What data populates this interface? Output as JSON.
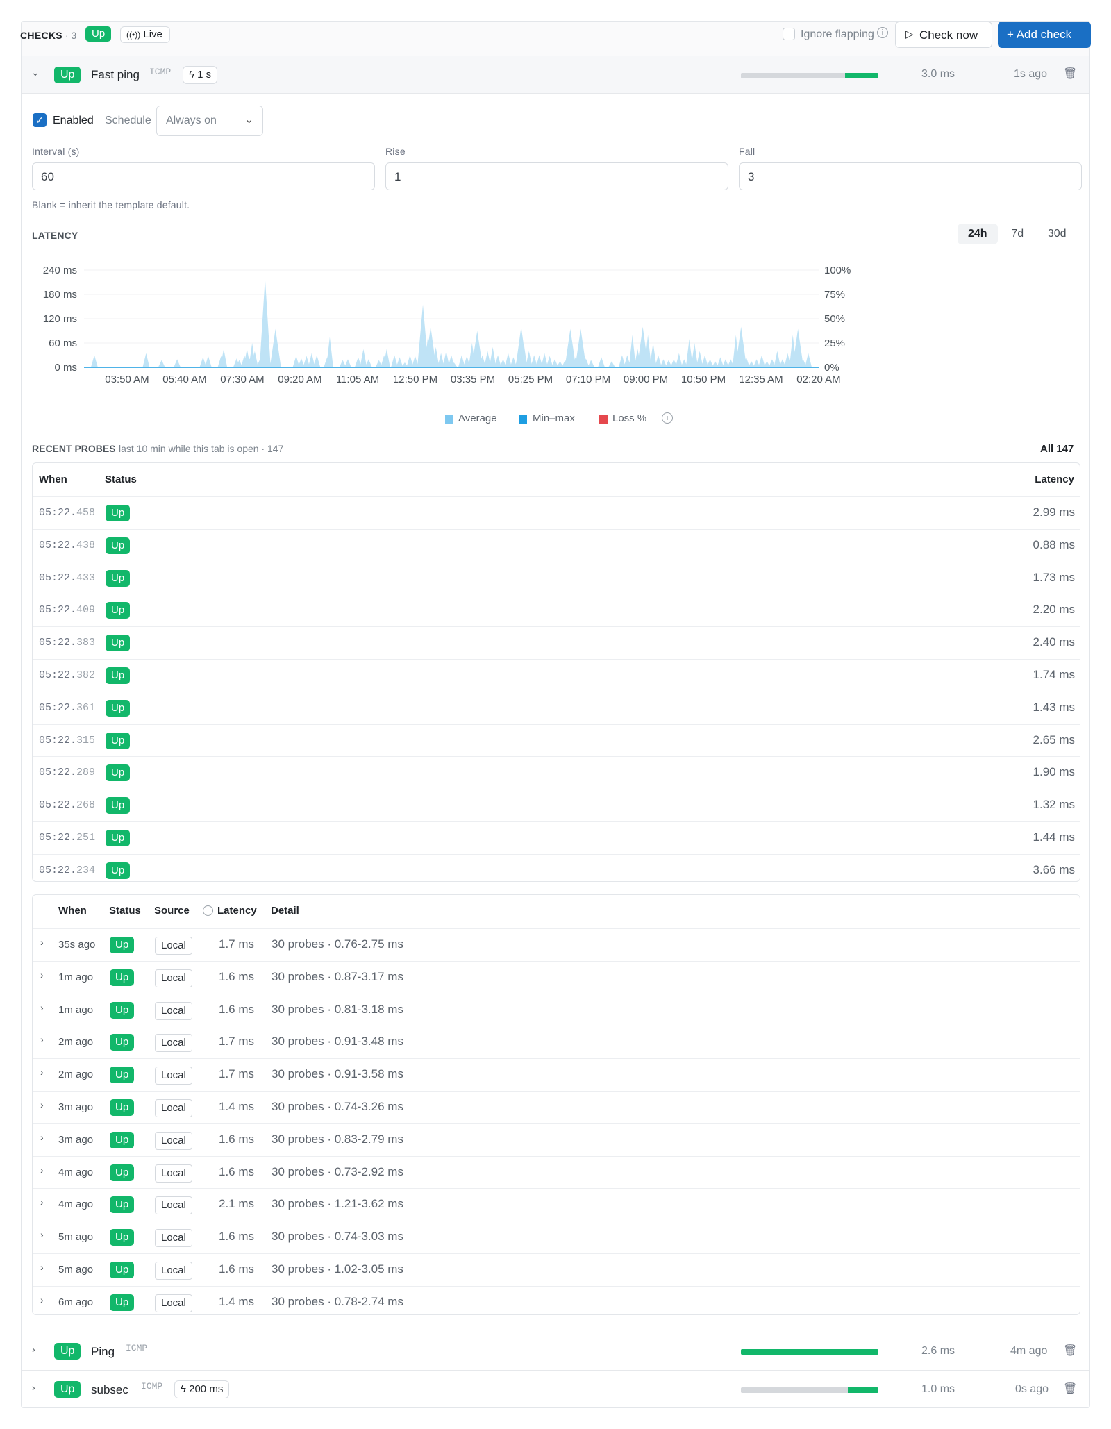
{
  "header": {
    "checks_label": "CHECKS",
    "checks_count": "· 3",
    "status": "Up",
    "live_label": "Live",
    "ignore_flapping": "Ignore flapping",
    "check_now": "Check now",
    "add_check": "+ Add check"
  },
  "check1": {
    "status": "Up",
    "name": "Fast ping",
    "type": "ICMP",
    "interval": "1 s",
    "bar_up_fraction": 0.24,
    "latency": "3.0 ms",
    "ago": "1s ago",
    "enabled_label": "Enabled",
    "schedule_label": "Schedule",
    "schedule_value": "Always on",
    "interval_label": "Interval (s)",
    "interval_value": "60",
    "rise_label": "Rise",
    "rise_value": "1",
    "fall_label": "Fall",
    "fall_value": "3",
    "hint": "Blank = inherit the template default."
  },
  "latency": {
    "title": "LATENCY",
    "ranges": [
      "24h",
      "7d",
      "30d"
    ],
    "active_range": "24h",
    "legend": [
      "Average",
      "Min–max",
      "Loss %"
    ]
  },
  "chart_data": {
    "type": "area",
    "y_ticks_left": [
      "240 ms",
      "180 ms",
      "120 ms",
      "60 ms",
      "0 ms"
    ],
    "y_ticks_right": [
      "100%",
      "75%",
      "50%",
      "25%",
      "0%"
    ],
    "x_ticks": [
      "03:50 AM",
      "05:40 AM",
      "07:30 AM",
      "09:20 AM",
      "11:05 AM",
      "12:50 PM",
      "03:35 PM",
      "05:25 PM",
      "07:10 PM",
      "09:00 PM",
      "10:50 PM",
      "12:35 AM",
      "02:20 AM"
    ],
    "ylim": [
      0,
      240
    ],
    "series": [
      {
        "name": "Average",
        "color": "#4fb3e8"
      },
      {
        "name": "Min–max",
        "color": "#bfe3f6"
      },
      {
        "name": "Loss %",
        "color": "#e5484d"
      }
    ],
    "spikes": [
      [
        0.02,
        30
      ],
      [
        0.12,
        35
      ],
      [
        0.15,
        18
      ],
      [
        0.18,
        20
      ],
      [
        0.23,
        25
      ],
      [
        0.24,
        28
      ],
      [
        0.265,
        28
      ],
      [
        0.27,
        45
      ],
      [
        0.295,
        22
      ],
      [
        0.3,
        18
      ],
      [
        0.31,
        30
      ],
      [
        0.315,
        45
      ],
      [
        0.32,
        22
      ],
      [
        0.325,
        60
      ],
      [
        0.33,
        40
      ],
      [
        0.34,
        20
      ],
      [
        0.35,
        220
      ],
      [
        0.37,
        95
      ],
      [
        0.41,
        28
      ],
      [
        0.42,
        22
      ],
      [
        0.43,
        28
      ],
      [
        0.44,
        35
      ],
      [
        0.45,
        30
      ],
      [
        0.47,
        25
      ],
      [
        0.475,
        75
      ],
      [
        0.5,
        18
      ],
      [
        0.51,
        20
      ],
      [
        0.53,
        25
      ],
      [
        0.54,
        45
      ],
      [
        0.55,
        20
      ],
      [
        0.57,
        18
      ],
      [
        0.58,
        30
      ],
      [
        0.585,
        45
      ],
      [
        0.6,
        30
      ],
      [
        0.61,
        25
      ],
      [
        0.62,
        12
      ],
      [
        0.63,
        30
      ],
      [
        0.64,
        28
      ],
      [
        0.65,
        45
      ],
      [
        0.655,
        155
      ],
      [
        0.66,
        40
      ],
      [
        0.665,
        80
      ],
      [
        0.67,
        100
      ],
      [
        0.68,
        50
      ],
      [
        0.69,
        35
      ],
      [
        0.7,
        40
      ],
      [
        0.71,
        30
      ],
      [
        0.715,
        12
      ],
      [
        0.73,
        30
      ],
      [
        0.74,
        28
      ],
      [
        0.75,
        60
      ],
      [
        0.76,
        90
      ],
      [
        0.77,
        30
      ],
      [
        0.78,
        40
      ],
      [
        0.79,
        50
      ],
      [
        0.8,
        30
      ],
      [
        0.81,
        20
      ],
      [
        0.82,
        35
      ],
      [
        0.83,
        25
      ],
      [
        0.84,
        40
      ],
      [
        0.845,
        100
      ],
      [
        0.85,
        60
      ],
      [
        0.86,
        40
      ],
      [
        0.87,
        30
      ],
      [
        0.88,
        30
      ],
      [
        0.89,
        35
      ],
      [
        0.9,
        28
      ],
      [
        0.91,
        20
      ],
      [
        0.92,
        15
      ],
      [
        0.93,
        18
      ],
      [
        0.94,
        95
      ],
      [
        0.95,
        25
      ],
      [
        0.96,
        95
      ],
      [
        0.97,
        22
      ],
      [
        0.98,
        18
      ],
      [
        1.0,
        25
      ],
      [
        1.02,
        15
      ],
      [
        1.04,
        30
      ],
      [
        1.05,
        30
      ],
      [
        1.06,
        80
      ],
      [
        1.07,
        45
      ],
      [
        1.08,
        100
      ],
      [
        1.09,
        80
      ],
      [
        1.1,
        60
      ],
      [
        1.11,
        30
      ],
      [
        1.12,
        20
      ],
      [
        1.13,
        18
      ],
      [
        1.14,
        20
      ],
      [
        1.15,
        35
      ],
      [
        1.16,
        20
      ],
      [
        1.17,
        70
      ],
      [
        1.18,
        60
      ],
      [
        1.19,
        40
      ],
      [
        1.2,
        30
      ],
      [
        1.21,
        20
      ],
      [
        1.22,
        15
      ],
      [
        1.23,
        25
      ],
      [
        1.24,
        20
      ],
      [
        1.25,
        20
      ],
      [
        1.26,
        80
      ],
      [
        1.27,
        100
      ],
      [
        1.28,
        25
      ],
      [
        1.29,
        15
      ],
      [
        1.3,
        20
      ],
      [
        1.31,
        30
      ],
      [
        1.32,
        15
      ],
      [
        1.33,
        20
      ],
      [
        1.34,
        40
      ],
      [
        1.35,
        20
      ],
      [
        1.36,
        35
      ],
      [
        1.37,
        80
      ],
      [
        1.38,
        95
      ],
      [
        1.39,
        20
      ],
      [
        1.4,
        35
      ]
    ]
  },
  "probes": {
    "title": "RECENT PROBES",
    "subtitle": "last 10 min while this tab is open · 147",
    "all_label": "All 147",
    "col_when": "When",
    "col_status": "Status",
    "col_latency": "Latency",
    "rows": [
      {
        "t": "05:22.",
        "ms": "458",
        "status": "Up",
        "latency": "2.99 ms"
      },
      {
        "t": "05:22.",
        "ms": "438",
        "status": "Up",
        "latency": "0.88 ms"
      },
      {
        "t": "05:22.",
        "ms": "433",
        "status": "Up",
        "latency": "1.73 ms"
      },
      {
        "t": "05:22.",
        "ms": "409",
        "status": "Up",
        "latency": "2.20 ms"
      },
      {
        "t": "05:22.",
        "ms": "383",
        "status": "Up",
        "latency": "2.40 ms"
      },
      {
        "t": "05:22.",
        "ms": "382",
        "status": "Up",
        "latency": "1.74 ms"
      },
      {
        "t": "05:22.",
        "ms": "361",
        "status": "Up",
        "latency": "1.43 ms"
      },
      {
        "t": "05:22.",
        "ms": "315",
        "status": "Up",
        "latency": "2.65 ms"
      },
      {
        "t": "05:22.",
        "ms": "289",
        "status": "Up",
        "latency": "1.90 ms"
      },
      {
        "t": "05:22.",
        "ms": "268",
        "status": "Up",
        "latency": "1.32 ms"
      },
      {
        "t": "05:22.",
        "ms": "251",
        "status": "Up",
        "latency": "1.44 ms"
      },
      {
        "t": "05:22.",
        "ms": "234",
        "status": "Up",
        "latency": "3.66 ms"
      }
    ]
  },
  "history": {
    "col_when": "When",
    "col_status": "Status",
    "col_source": "Source",
    "col_latency": "Latency",
    "col_detail": "Detail",
    "rows": [
      {
        "when": "35s ago",
        "status": "Up",
        "source": "Local",
        "latency": "1.7 ms",
        "detail": "30 probes · 0.76-2.75 ms"
      },
      {
        "when": "1m ago",
        "status": "Up",
        "source": "Local",
        "latency": "1.6 ms",
        "detail": "30 probes · 0.87-3.17 ms"
      },
      {
        "when": "1m ago",
        "status": "Up",
        "source": "Local",
        "latency": "1.6 ms",
        "detail": "30 probes · 0.81-3.18 ms"
      },
      {
        "when": "2m ago",
        "status": "Up",
        "source": "Local",
        "latency": "1.7 ms",
        "detail": "30 probes · 0.91-3.48 ms"
      },
      {
        "when": "2m ago",
        "status": "Up",
        "source": "Local",
        "latency": "1.7 ms",
        "detail": "30 probes · 0.91-3.58 ms"
      },
      {
        "when": "3m ago",
        "status": "Up",
        "source": "Local",
        "latency": "1.4 ms",
        "detail": "30 probes · 0.74-3.26 ms"
      },
      {
        "when": "3m ago",
        "status": "Up",
        "source": "Local",
        "latency": "1.6 ms",
        "detail": "30 probes · 0.83-2.79 ms"
      },
      {
        "when": "4m ago",
        "status": "Up",
        "source": "Local",
        "latency": "1.6 ms",
        "detail": "30 probes · 0.73-2.92 ms"
      },
      {
        "when": "4m ago",
        "status": "Up",
        "source": "Local",
        "latency": "2.1 ms",
        "detail": "30 probes · 1.21-3.62 ms"
      },
      {
        "when": "5m ago",
        "status": "Up",
        "source": "Local",
        "latency": "1.6 ms",
        "detail": "30 probes · 0.74-3.03 ms"
      },
      {
        "when": "5m ago",
        "status": "Up",
        "source": "Local",
        "latency": "1.6 ms",
        "detail": "30 probes · 1.02-3.05 ms"
      },
      {
        "when": "6m ago",
        "status": "Up",
        "source": "Local",
        "latency": "1.4 ms",
        "detail": "30 probes · 0.78-2.74 ms"
      }
    ]
  },
  "check2": {
    "status": "Up",
    "name": "Ping",
    "type": "ICMP",
    "bar_up_fraction": 1.0,
    "latency": "2.6 ms",
    "ago": "4m ago"
  },
  "check3": {
    "status": "Up",
    "name": "subsec",
    "type": "ICMP",
    "interval": "200 ms",
    "bar_up_fraction": 0.22,
    "latency": "1.0 ms",
    "ago": "0s ago"
  }
}
